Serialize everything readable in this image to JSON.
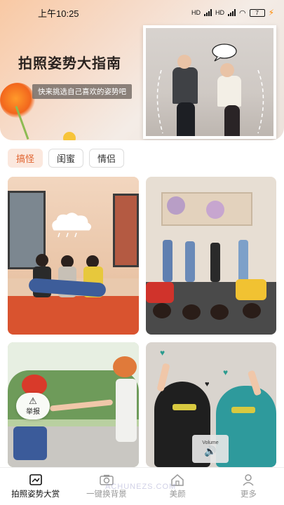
{
  "status_bar": {
    "time": "上午10:25",
    "battery": "7",
    "network_tags": [
      "HD",
      "HD"
    ]
  },
  "banner": {
    "title": "拍照姿势大指南",
    "subtitle": "快来挑选自己喜欢的姿势吧"
  },
  "tabs": [
    {
      "label": "搞怪",
      "active": true
    },
    {
      "label": "闺蜜",
      "active": false
    },
    {
      "label": "情侣",
      "active": false
    }
  ],
  "overlays": {
    "report_label": "举报",
    "voice_label": "Volume"
  },
  "bottom_nav": [
    {
      "label": "拍照姿势大赏",
      "icon": "photo-icon",
      "active": true
    },
    {
      "label": "一键换背景",
      "icon": "camera-icon",
      "active": false
    },
    {
      "label": "美颜",
      "icon": "home-icon",
      "active": false
    },
    {
      "label": "更多",
      "icon": "user-icon",
      "active": false
    }
  ],
  "watermark": "ACHUNEZS.COM",
  "colors": {
    "accent": "#e0622d",
    "active_tab_bg": "#fbe8de",
    "charging": "#ff8a00"
  }
}
